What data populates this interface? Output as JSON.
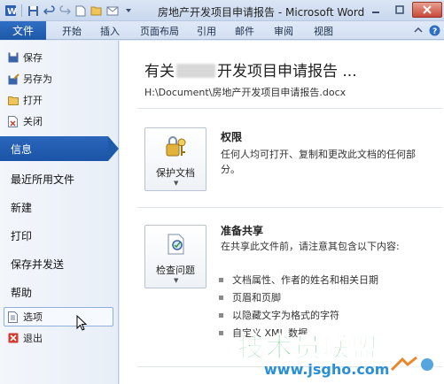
{
  "window": {
    "title": "房地产开发项目申请报告 - Microsoft Word"
  },
  "quick_access": {
    "icons": [
      "word-app-icon",
      "save-icon",
      "undo-icon",
      "redo-icon",
      "new-doc-icon",
      "open-folder-icon",
      "email-icon",
      "customize-icon"
    ]
  },
  "ribbon": {
    "file_tab": "文件",
    "tabs": [
      "开始",
      "插入",
      "页面布局",
      "引用",
      "邮件",
      "审阅",
      "视图"
    ]
  },
  "nav": {
    "small_items": [
      {
        "label": "保存",
        "icon": "save-icon"
      },
      {
        "label": "另存为",
        "icon": "save-as-icon"
      },
      {
        "label": "打开",
        "icon": "open-folder-icon"
      },
      {
        "label": "关闭",
        "icon": "close-doc-icon"
      }
    ],
    "selected": "信息",
    "big_items": [
      "最近所用文件",
      "新建",
      "打印",
      "保存并发送",
      "帮助"
    ],
    "options": "选项",
    "exit": "退出"
  },
  "main": {
    "title_prefix": "有关",
    "title_suffix": "开发项目申请报告 ...",
    "path": "H:\\Document\\房地产开发项目申请报告.docx",
    "permissions": {
      "button_label": "保护文档",
      "heading": "权限",
      "description": "任何人均可打开、复制和更改此文档的任何部分。"
    },
    "prepare": {
      "button_label": "检查问题",
      "heading": "准备共享",
      "description": "在共享此文件前，请注意其包含以下内容:",
      "bullets": [
        "文档属性、作者的姓名和相关日期",
        "页眉和页脚",
        "以隐藏文字为格式的字符",
        "自定义 XML 数据"
      ]
    }
  },
  "watermark": {
    "text": "技术员联盟",
    "url": "www.jsgho.com"
  },
  "colors": {
    "file_tab": "#2a66bb",
    "nav_selected": "#1f59aa",
    "watermark_green": "#2fb45a",
    "watermark_blue": "#2a8fd6"
  }
}
